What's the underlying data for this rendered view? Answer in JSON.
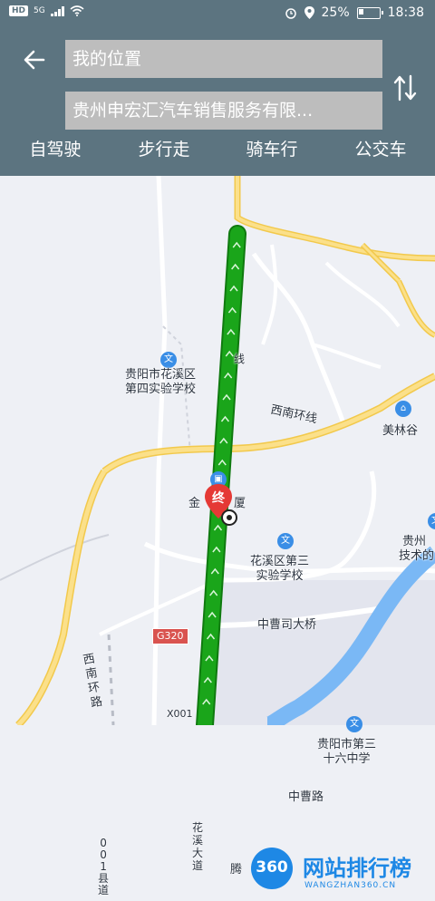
{
  "status_bar": {
    "hd": "HD",
    "signal": "5G",
    "battery_percent": "25%",
    "time": "18:38"
  },
  "header": {
    "back_icon": "back-arrow-icon",
    "from_field": "我的位置",
    "to_field": "贵州申宏汇汽车销售服务有限...",
    "swap_icon": "swap-icon"
  },
  "modes": [
    {
      "label": "自驾驶"
    },
    {
      "label": "步行走"
    },
    {
      "label": "骑车行"
    },
    {
      "label": "公交车"
    }
  ],
  "map": {
    "labels": {
      "school4": "贵阳市花溪区\n第四实验学校",
      "road_xinan_ring": "西南环线",
      "meilin": "美林谷",
      "jin": "金",
      "sha": "厦",
      "school3": "花溪区第三\n实验学校",
      "guizhou": "贵州",
      "jishu": "技术的",
      "zhongcaosi": "中曹司大桥",
      "g320": "G320",
      "xinan_ring_road": "西\n南\n环\n路",
      "x001": "X001",
      "school36": "贵阳市第三\n十六中学",
      "zhongcao_road": "中曹路",
      "huaxi_avenue": "花\n溪\n大\n道",
      "county_road": "0\n0\n1\n县\n道",
      "teng": "腾",
      "top_road": "线"
    },
    "end_marker": "终",
    "route_color": "#1aa51a",
    "watermark_num": "360",
    "watermark_text": "网站排行榜",
    "watermark_url": "WANGZHAN360.CN"
  }
}
